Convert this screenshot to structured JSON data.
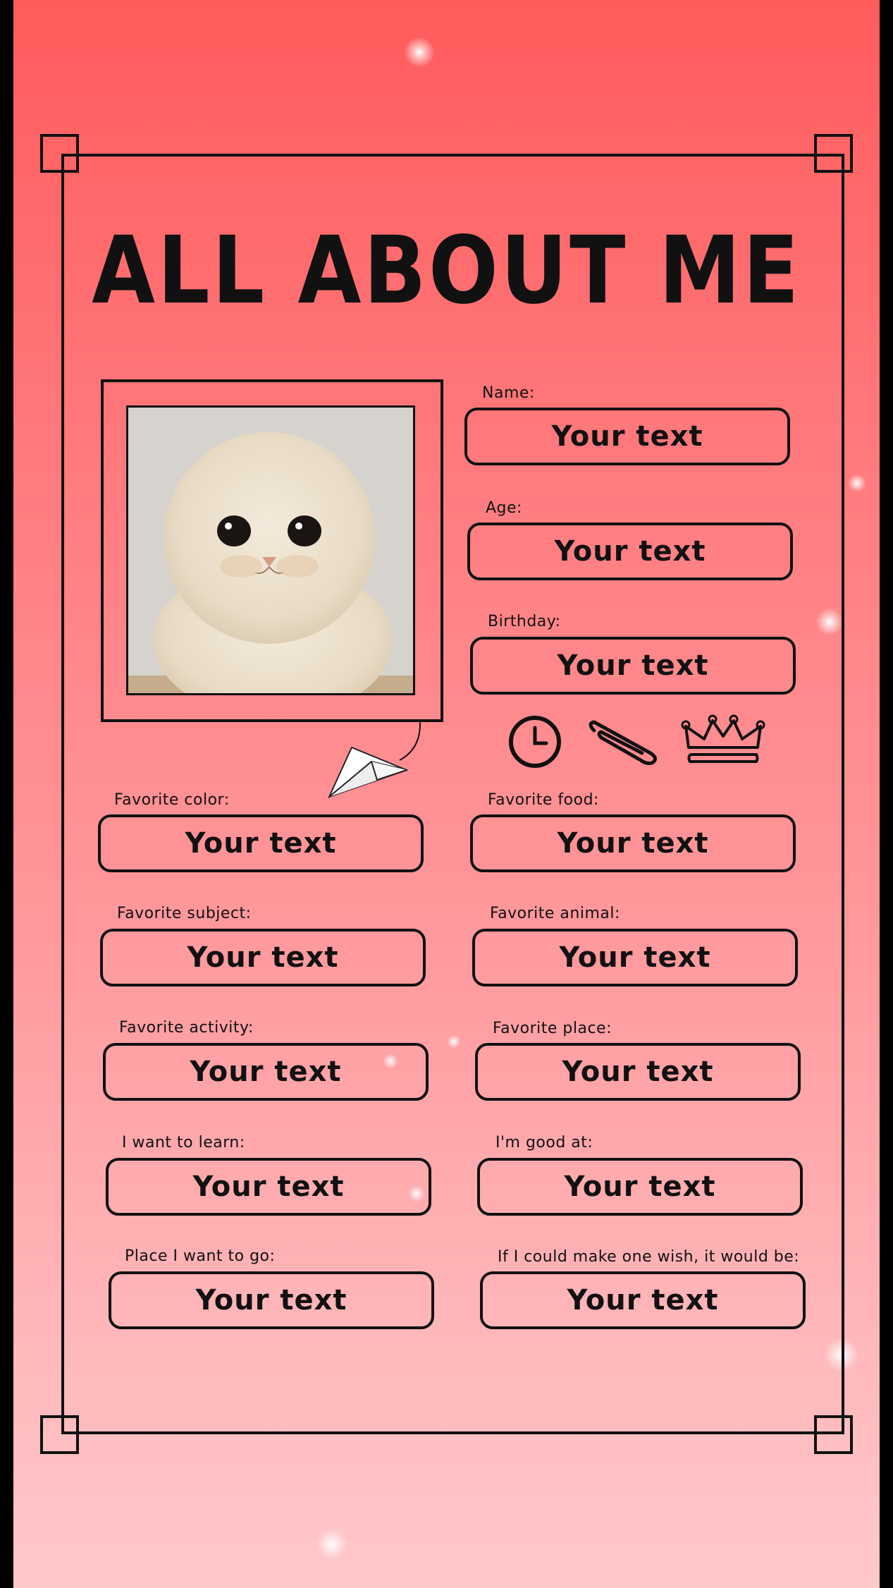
{
  "title": "ALL ABOUT ME",
  "photo": {
    "subject": "cream kitten"
  },
  "fields": {
    "name": {
      "label": "Name:",
      "value": "Your text"
    },
    "age": {
      "label": "Age:",
      "value": "Your text"
    },
    "birthday": {
      "label": "Birthday:",
      "value": "Your text"
    },
    "fav_color": {
      "label": "Favorite color:",
      "value": "Your text"
    },
    "fav_food": {
      "label": "Favorite food:",
      "value": "Your text"
    },
    "fav_subject": {
      "label": "Favorite subject:",
      "value": "Your text"
    },
    "fav_animal": {
      "label": "Favorite animal:",
      "value": "Your text"
    },
    "fav_activity": {
      "label": "Favorite activity:",
      "value": "Your text"
    },
    "fav_place": {
      "label": "Favorite place:",
      "value": "Your text"
    },
    "want_learn": {
      "label": "I want to learn:",
      "value": "Your text"
    },
    "good_at": {
      "label": "I'm good at:",
      "value": "Your text"
    },
    "place_go": {
      "label": "Place I want to go:",
      "value": "Your text"
    },
    "wish": {
      "label": "If I could make one wish, it would be:",
      "value": "Your text"
    }
  },
  "decorations": [
    "clock-icon",
    "paperclip-icon",
    "crown-icon",
    "paper-plane-icon"
  ],
  "colors": {
    "background_top": "#ff5b5c",
    "background_bottom": "#ffc8cb",
    "ink": "#111111"
  }
}
